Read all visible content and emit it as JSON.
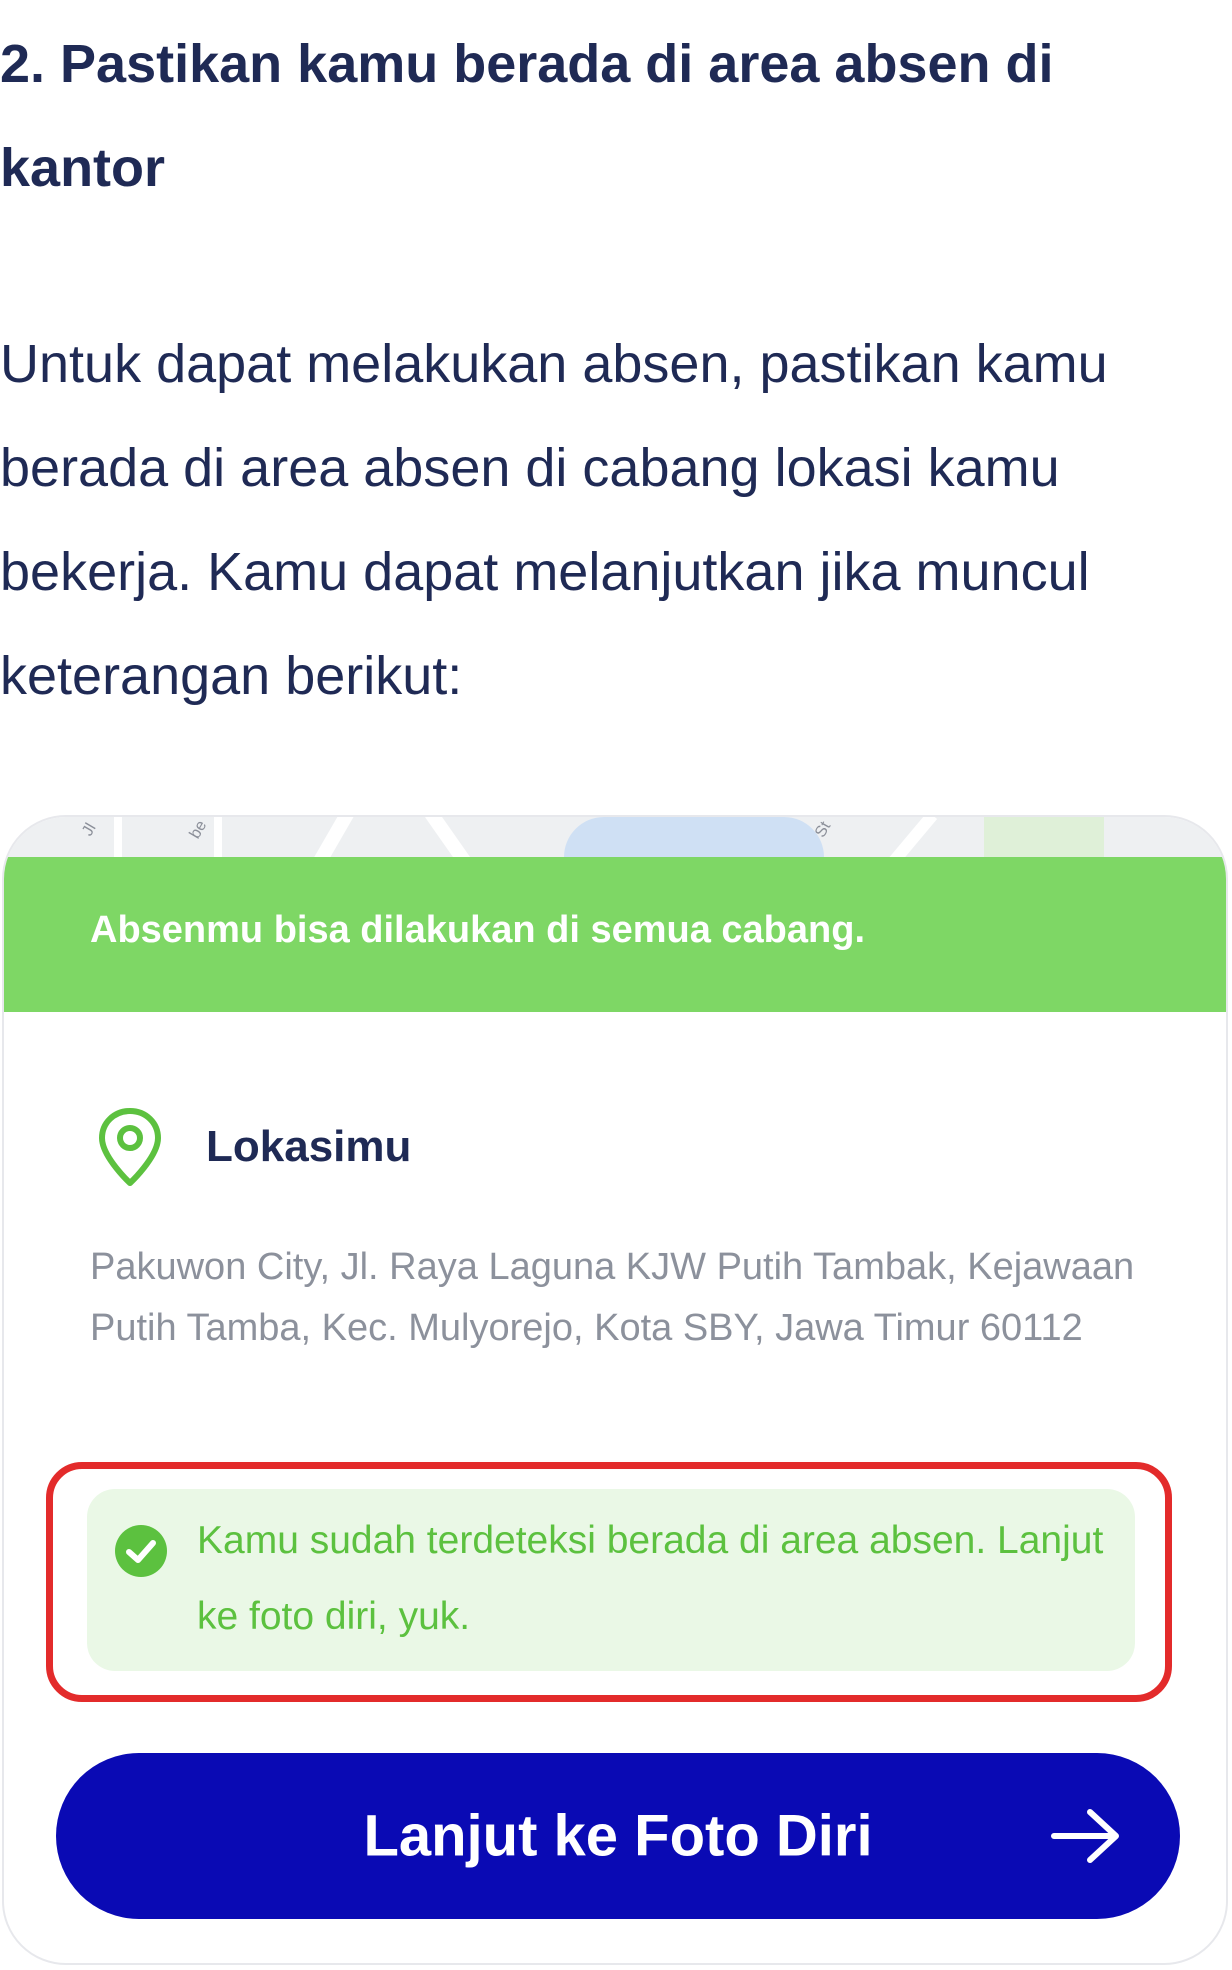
{
  "article": {
    "heading": "2. Pastikan kamu berada di area absen di kantor",
    "paragraph": "Untuk dapat melakukan absen, pastikan kamu berada di area absen di cabang lokasi kamu bekerja. Kamu dapat melanjutkan jika muncul keterangan berikut:"
  },
  "card": {
    "map_labels": [
      "Jl",
      "be",
      "St"
    ],
    "banner_text": "Absenmu bisa dilakukan di semua cabang.",
    "location_icon": "map-pin-icon",
    "location_title": "Lokasimu",
    "address": "Pakuwon City, Jl. Raya Laguna KJW Putih Tambak, Kejawaan Putih Tamba, Kec. Mulyorejo, Kota SBY, Jawa Timur 60112",
    "status_icon": "check-circle-icon",
    "status_text": "Kamu sudah terdeteksi berada di area absen. Lanjut ke foto diri, yuk.",
    "button_label": "Lanjut ke Foto Diri",
    "button_icon": "arrow-right-icon"
  },
  "colors": {
    "text_primary": "#1f2a55",
    "banner_green": "#7ed765",
    "status_green": "#5cc13f",
    "status_bg": "#eaf8e6",
    "highlight_red": "#e32b2b",
    "button_blue": "#0a0ab4",
    "address_grey": "#8c919c"
  }
}
